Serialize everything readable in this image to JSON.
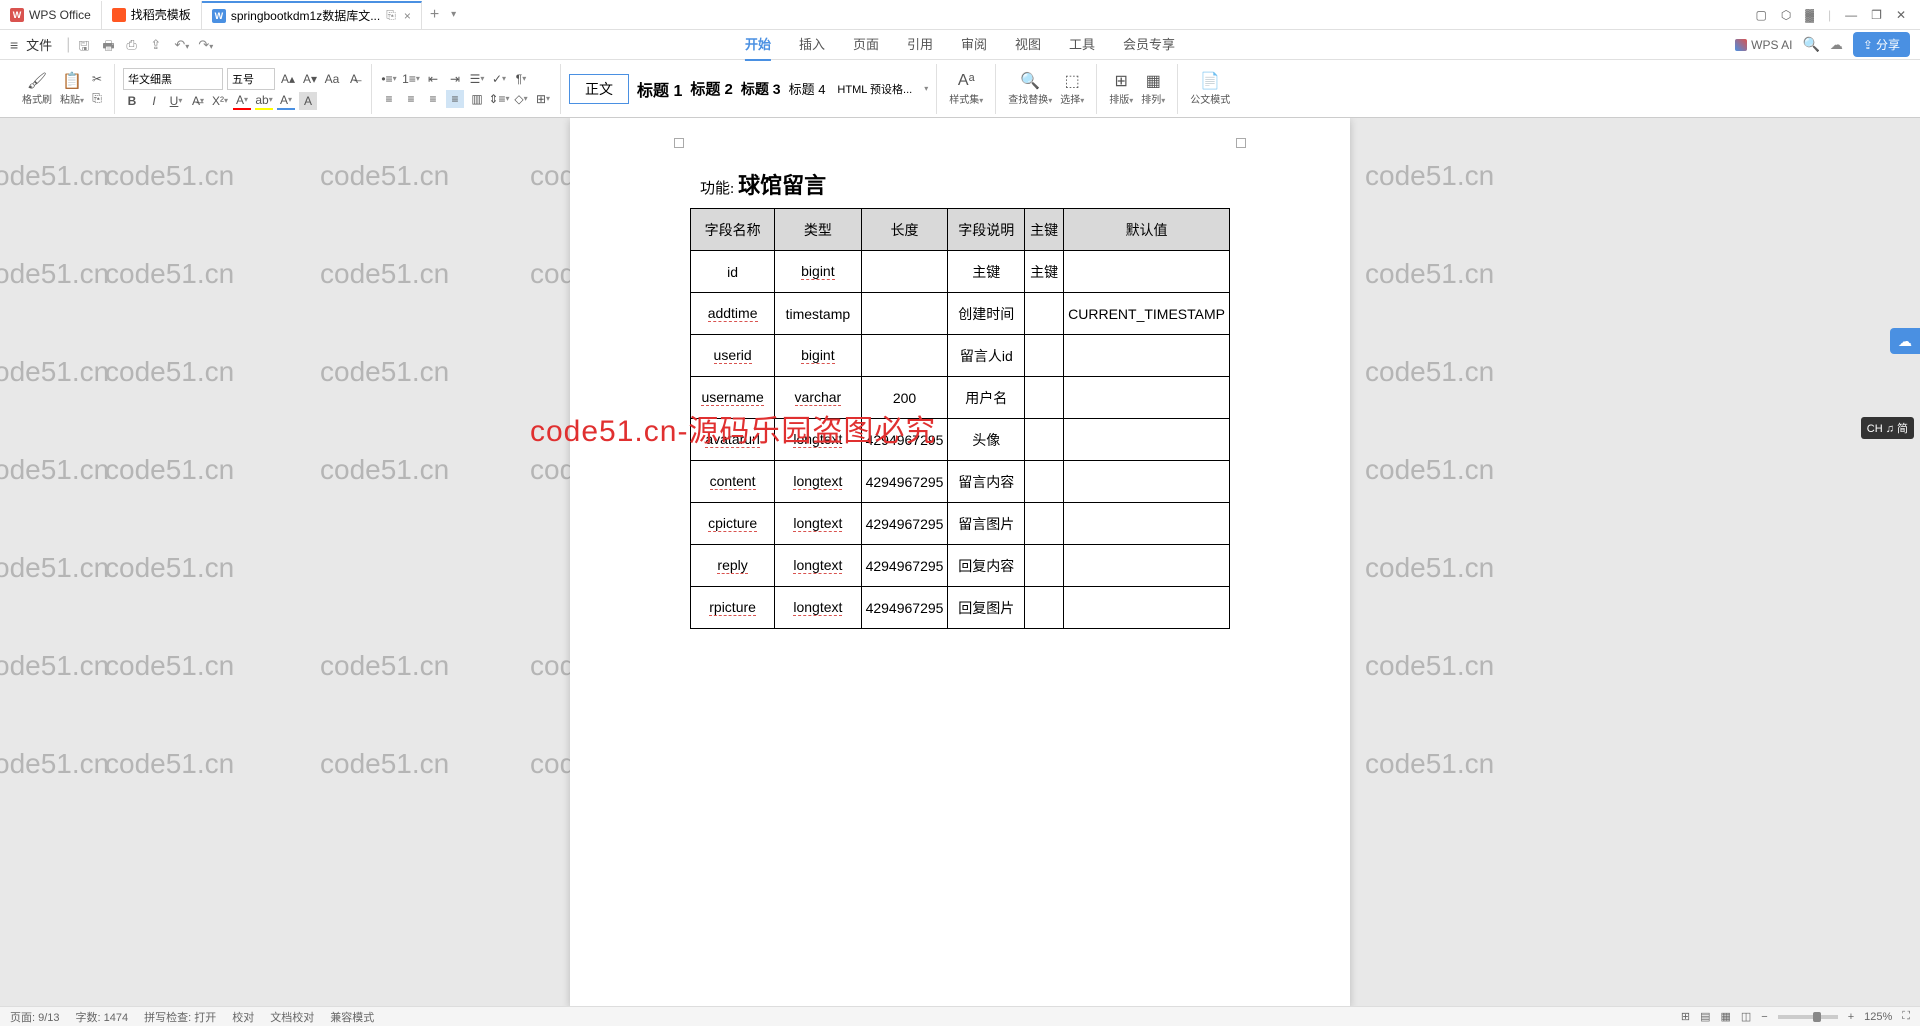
{
  "titlebar": {
    "app_name": "WPS Office",
    "template_tab": "找稻壳模板",
    "doc_tab": "springbootkdm1z数据库文...",
    "add": "+"
  },
  "menubar": {
    "file": "文件",
    "tabs": {
      "start": "开始",
      "insert": "插入",
      "page": "页面",
      "reference": "引用",
      "review": "审阅",
      "view": "视图",
      "tools": "工具",
      "member": "会员专享"
    },
    "wps_ai": "WPS AI",
    "share": "分享"
  },
  "ribbon": {
    "format_painter": "格式刷",
    "paste": "粘贴",
    "font_name": "华文细黑",
    "font_size": "五号",
    "styles": {
      "normal": "正文",
      "h1": "标题 1",
      "h2": "标题 2",
      "h3": "标题 3",
      "h4": "标题 4",
      "html": "HTML 预设格..."
    },
    "styles_set": "样式集",
    "find_replace": "查找替换",
    "select": "选择",
    "outline": "排版",
    "arrange": "排列",
    "doc_mode": "公文模式"
  },
  "document": {
    "function_label": "功能:",
    "function_text": "球馆留言",
    "table": {
      "headers": {
        "name": "字段名称",
        "type": "类型",
        "length": "长度",
        "desc": "字段说明",
        "pk": "主键",
        "default": "默认值"
      },
      "rows": [
        {
          "name": "id",
          "type": "bigint",
          "length": "",
          "desc": "主键",
          "pk": "主键",
          "default": ""
        },
        {
          "name": "addtime",
          "type": "timestamp",
          "length": "",
          "desc": "创建时间",
          "pk": "",
          "default": "CURRENT_TIMESTAMP"
        },
        {
          "name": "userid",
          "type": "bigint",
          "length": "",
          "desc": "留言人id",
          "pk": "",
          "default": ""
        },
        {
          "name": "username",
          "type": "varchar",
          "length": "200",
          "desc": "用户名",
          "pk": "",
          "default": ""
        },
        {
          "name": "avatarurl",
          "type": "longtext",
          "length": "4294967295",
          "desc": "头像",
          "pk": "",
          "default": ""
        },
        {
          "name": "content",
          "type": "longtext",
          "length": "4294967295",
          "desc": "留言内容",
          "pk": "",
          "default": ""
        },
        {
          "name": "cpicture",
          "type": "longtext",
          "length": "4294967295",
          "desc": "留言图片",
          "pk": "",
          "default": ""
        },
        {
          "name": "reply",
          "type": "longtext",
          "length": "4294967295",
          "desc": "回复内容",
          "pk": "",
          "default": ""
        },
        {
          "name": "rpicture",
          "type": "longtext",
          "length": "4294967295",
          "desc": "回复图片",
          "pk": "",
          "default": ""
        }
      ]
    }
  },
  "watermark": {
    "text": "code51.cn",
    "overlay": "code51.cn-源码乐园盗图必究"
  },
  "statusbar": {
    "page": "页面: 9/13",
    "words": "字数: 1474",
    "spell": "拼写检查: 打开",
    "proof": "校对",
    "doc_proof": "文档校对",
    "mode": "兼容模式",
    "zoom": "125%"
  },
  "ime": "CH ♫ 简"
}
